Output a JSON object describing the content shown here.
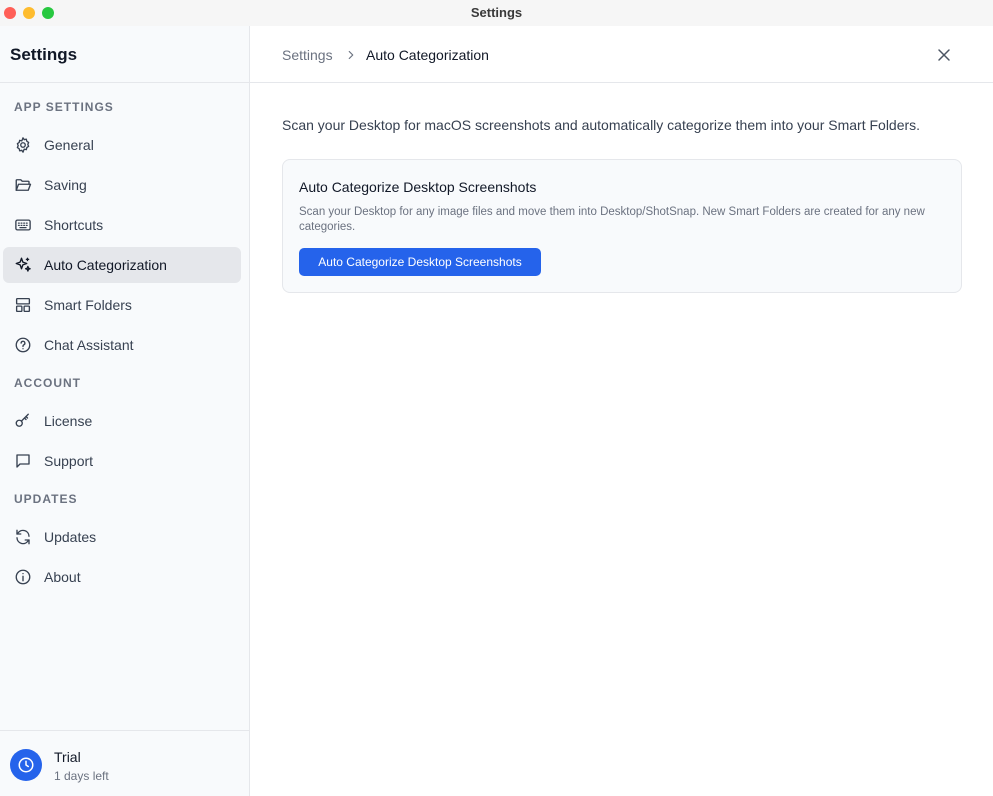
{
  "window": {
    "title": "Settings"
  },
  "sidebar": {
    "title": "Settings",
    "sections": {
      "app_settings": "APP SETTINGS",
      "account": "ACCOUNT",
      "updates": "UPDATES"
    },
    "items": [
      {
        "label": "General",
        "icon": "gear-icon"
      },
      {
        "label": "Saving",
        "icon": "folder-open-icon"
      },
      {
        "label": "Shortcuts",
        "icon": "keyboard-icon"
      },
      {
        "label": "Auto Categorization",
        "icon": "sparkles-icon",
        "active": true
      },
      {
        "label": "Smart Folders",
        "icon": "layout-icon"
      },
      {
        "label": "Chat Assistant",
        "icon": "help-circle-icon"
      },
      {
        "label": "License",
        "icon": "key-icon"
      },
      {
        "label": "Support",
        "icon": "message-icon"
      },
      {
        "label": "Updates",
        "icon": "refresh-icon"
      },
      {
        "label": "About",
        "icon": "info-icon"
      }
    ],
    "footer": {
      "title": "Trial",
      "subtitle": "1 days left",
      "icon": "clock-icon"
    }
  },
  "header": {
    "breadcrumb_root": "Settings",
    "breadcrumb_current": "Auto Categorization"
  },
  "main": {
    "intro": "Scan your Desktop for macOS screenshots and automatically categorize them into your Smart Folders.",
    "card": {
      "title": "Auto Categorize Desktop Screenshots",
      "description": "Scan your Desktop for any image files and move them into Desktop/ShotSnap. New Smart Folders are created for any new categories.",
      "button_label": "Auto Categorize Desktop Screenshots"
    }
  },
  "colors": {
    "accent": "#2563eb",
    "sidebar_bg": "#f8fafc",
    "active_item_bg": "#e5e7eb"
  }
}
